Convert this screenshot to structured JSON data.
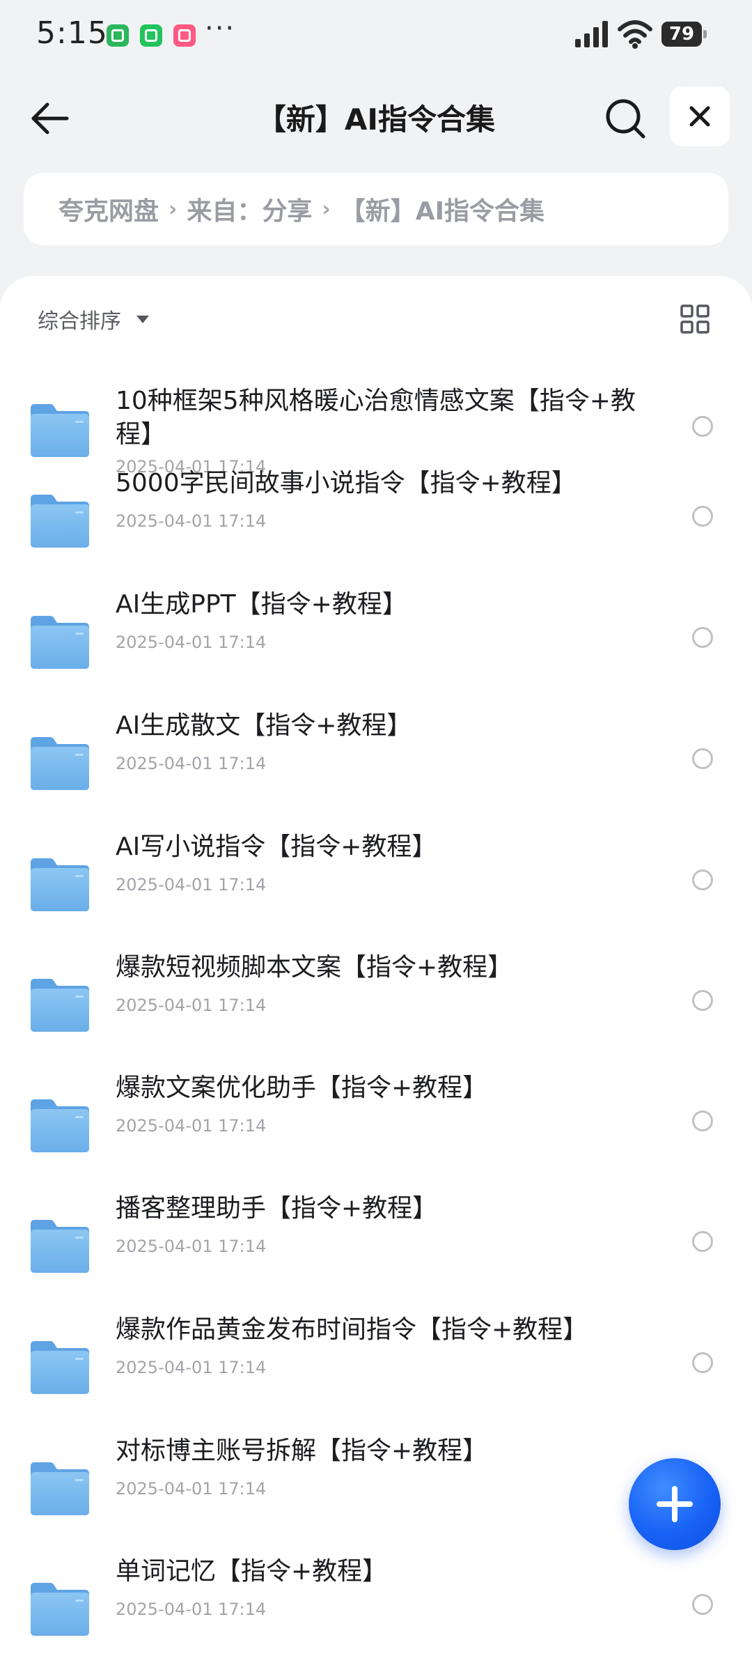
{
  "status_bar": {
    "time": "5:15",
    "more": "···",
    "battery": "79"
  },
  "header": {
    "title": "【新】AI指令合集"
  },
  "breadcrumb": [
    {
      "label": "夸克网盘"
    },
    {
      "label": "来自：分享"
    },
    {
      "label": "【新】AI指令合集"
    }
  ],
  "breadcrumb_separator": "›",
  "sort": {
    "label": "综合排序"
  },
  "files": [
    {
      "name": "10种框架5种风格暖心治愈情感文案【指令+教程】",
      "date": "2025-04-01 17:14"
    },
    {
      "name": "5000字民间故事小说指令【指令+教程】",
      "date": "2025-04-01 17:14"
    },
    {
      "name": "AI生成PPT【指令+教程】",
      "date": "2025-04-01 17:14"
    },
    {
      "name": "AI生成散文【指令+教程】",
      "date": "2025-04-01 17:14"
    },
    {
      "name": "AI写小说指令【指令+教程】",
      "date": "2025-04-01 17:14"
    },
    {
      "name": "爆款短视频脚本文案【指令+教程】",
      "date": "2025-04-01 17:14"
    },
    {
      "name": "爆款文案优化助手【指令+教程】",
      "date": "2025-04-01 17:14"
    },
    {
      "name": "播客整理助手【指令+教程】",
      "date": "2025-04-01 17:14"
    },
    {
      "name": "爆款作品黄金发布时间指令【指令+教程】",
      "date": "2025-04-01 17:14"
    },
    {
      "name": "对标博主账号拆解【指令+教程】",
      "date": "2025-04-01 17:14"
    },
    {
      "name": "单词记忆【指令+教程】",
      "date": "2025-04-01 17:14"
    }
  ],
  "icons": {
    "back": "arrow-left-icon",
    "search": "search-icon",
    "close": "close-icon",
    "grid": "grid-view-icon",
    "folder": "folder-icon",
    "add": "plus-icon"
  },
  "colors": {
    "accent": "#1862f5",
    "folder": "#7ab9ee",
    "background": "#f1f2f4"
  }
}
